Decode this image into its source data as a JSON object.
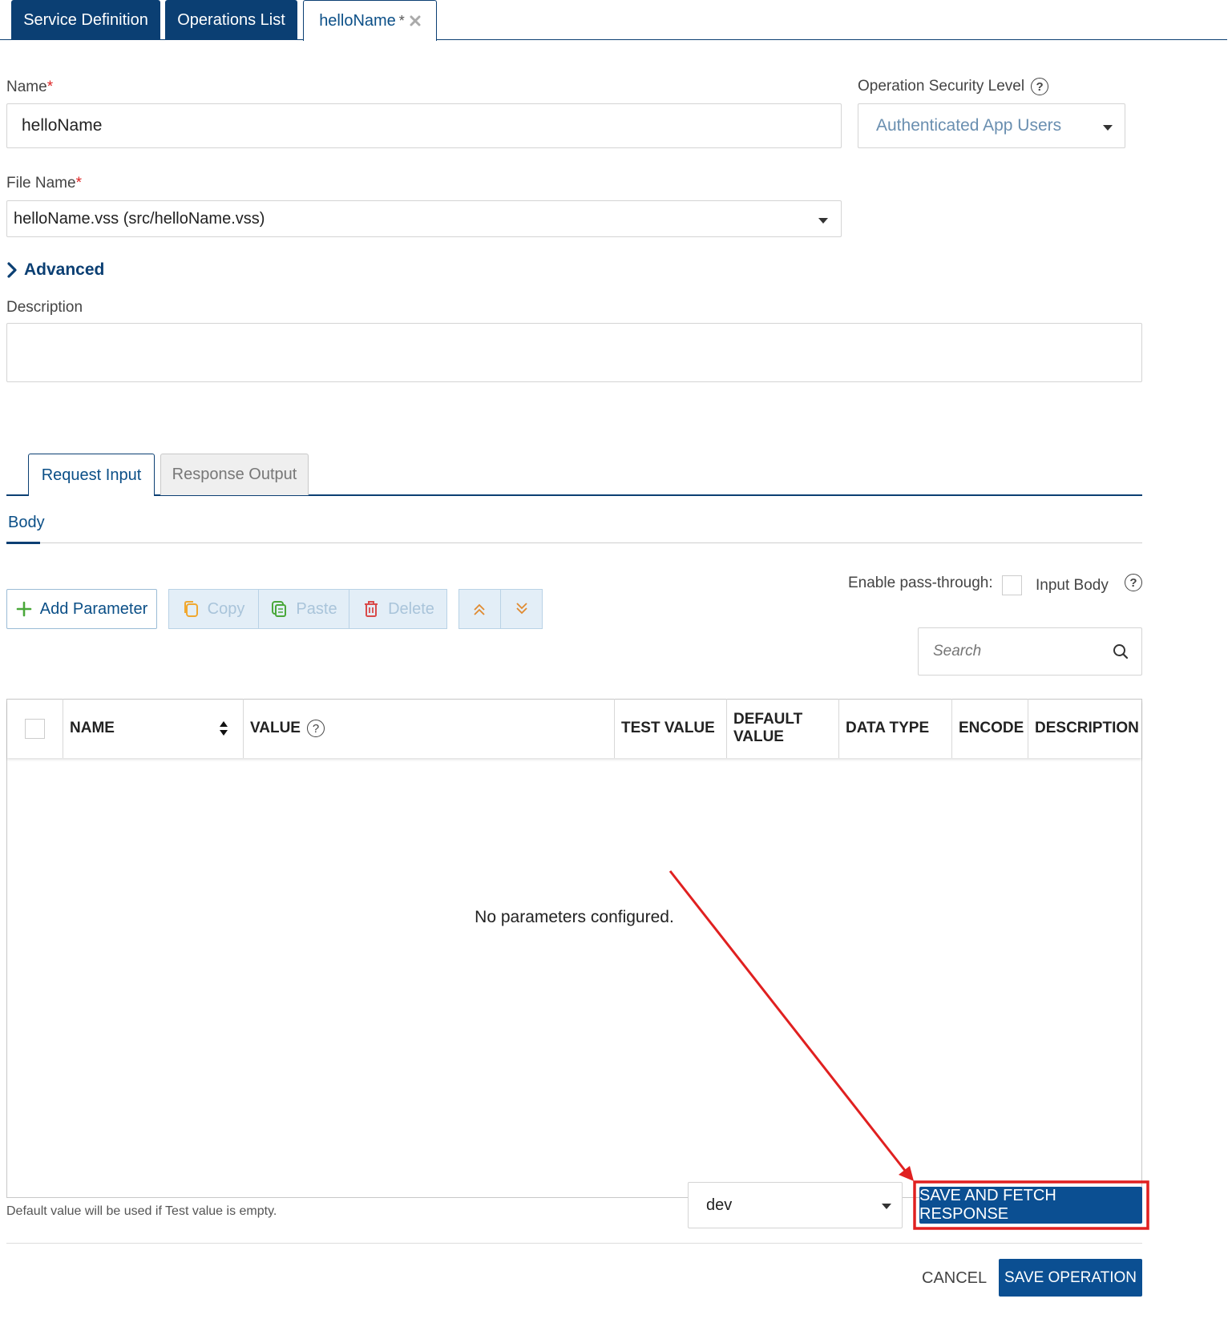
{
  "top_tabs": [
    {
      "label": "Service Definition"
    },
    {
      "label": "Operations List"
    },
    {
      "label": "helloName",
      "modified": "*"
    }
  ],
  "form": {
    "name_label": "Name",
    "name_value": "helloName",
    "security_label": "Operation Security Level",
    "security_value": "Authenticated App Users",
    "file_label": "File Name",
    "file_value": "helloName.vss (src/helloName.vss)",
    "required_mark": "*",
    "advanced_label": "Advanced",
    "description_label": "Description",
    "description_value": ""
  },
  "inner_tabs": [
    {
      "label": "Request Input"
    },
    {
      "label": "Response Output"
    }
  ],
  "sub_tab": {
    "label": "Body"
  },
  "toolbar": {
    "add_parameter": "Add Parameter",
    "copy": "Copy",
    "paste": "Paste",
    "delete": "Delete",
    "pass_through_label": "Enable pass-through:",
    "input_body_label": "Input Body",
    "search_placeholder": "Search"
  },
  "table": {
    "columns": [
      "NAME",
      "VALUE",
      "TEST VALUE",
      "DEFAULT VALUE",
      "DATA TYPE",
      "ENCODE",
      "DESCRIPTION"
    ],
    "empty_message": "No parameters configured."
  },
  "footer": {
    "hint": "Default value will be used if Test value is empty.",
    "environment": "dev",
    "save_fetch": "SAVE AND FETCH RESPONSE",
    "cancel": "CANCEL",
    "save_operation": "SAVE OPERATION"
  },
  "help_glyph": "?",
  "colors": {
    "primary": "#0b4f92",
    "tab_dark": "#0b3f73",
    "annotation": "#e02020"
  }
}
